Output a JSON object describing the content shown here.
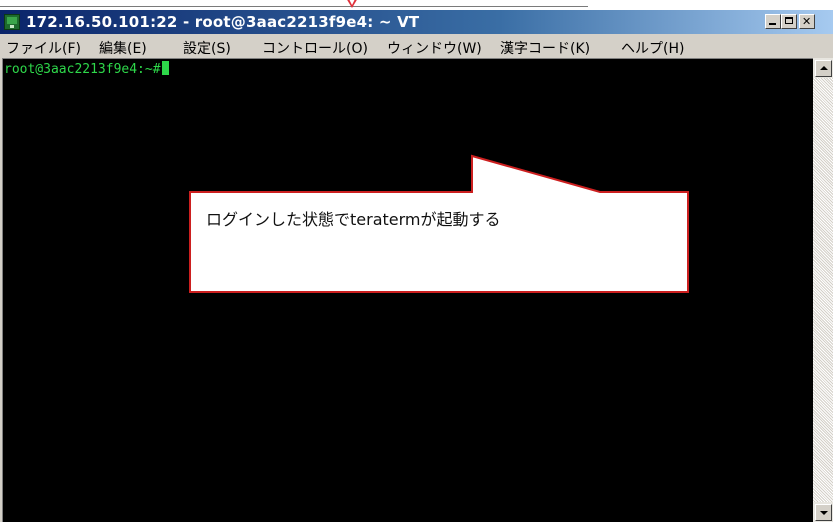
{
  "window": {
    "title": "172.16.50.101:22 - root@3aac2213f9e4: ~ VT"
  },
  "menu": {
    "items": [
      "ファイル(F)",
      "編集(E)",
      "設定(S)",
      "コントロール(O)",
      "ウィンドウ(W)",
      "漢字コード(K)",
      "ヘルプ(H)"
    ]
  },
  "terminal": {
    "prompt": "root@3aac2213f9e4:~#"
  },
  "callout": {
    "text": "ログインした状態でteratermが起動する"
  },
  "icons": {
    "app": "teraterm-app-icon",
    "minimize": "minimize-icon",
    "maximize": "maximize-icon",
    "close": "close-icon",
    "scroll_up": "scroll-up-arrow-icon",
    "scroll_down": "scroll-down-arrow-icon",
    "pin": "red-pointer-arrow-icon"
  },
  "colors": {
    "titlebar_start": "#0a246a",
    "titlebar_end": "#a6caf0",
    "terminal_bg": "#000000",
    "terminal_fg": "#2ed84a",
    "callout_border": "#cc1f1f",
    "callout_fill": "#ffffff"
  }
}
